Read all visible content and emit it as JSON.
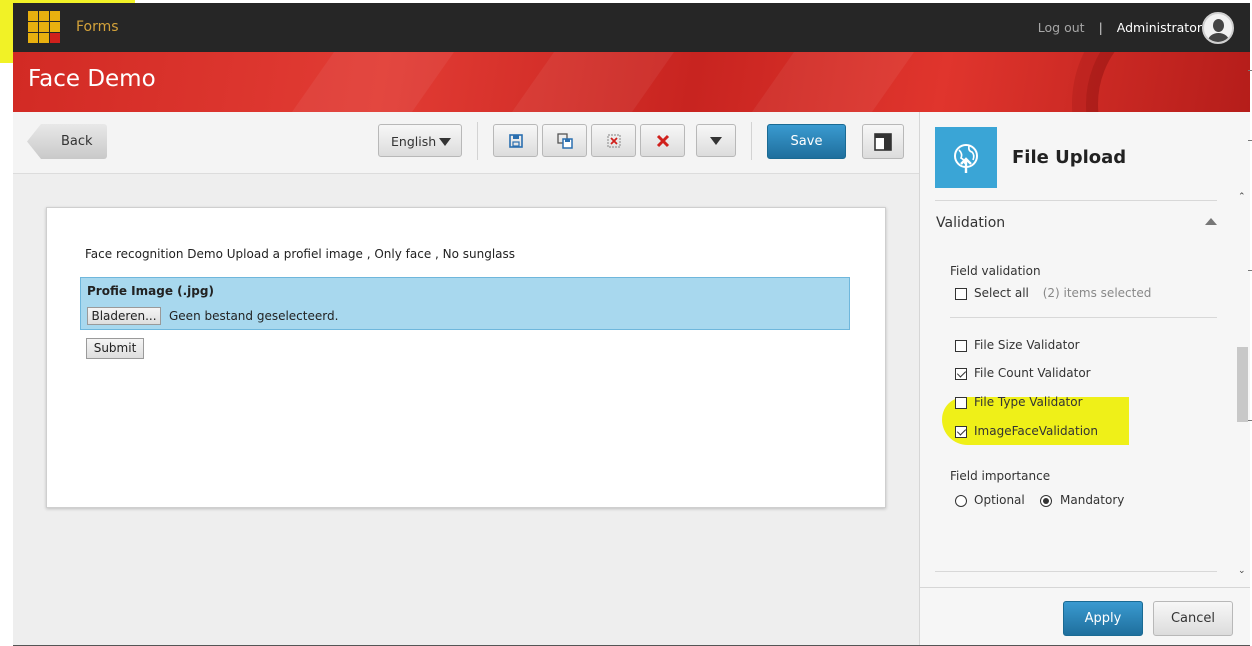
{
  "topbar": {
    "app_name": "Forms",
    "logout": "Log out",
    "separator": "|",
    "user": "Administrator"
  },
  "header": {
    "page_title": "Face Demo"
  },
  "toolbar": {
    "back_label": "Back",
    "language": "English",
    "save_label": "Save",
    "icons": [
      "save-icon",
      "save-as-icon",
      "discard-icon",
      "delete-icon",
      "more-dropdown-icon",
      "layout-panel-icon"
    ]
  },
  "form": {
    "description": "Face recognition Demo Upload a profiel image , Only face , No sunglass",
    "field_label": "Profie Image (.jpg)",
    "browse_label": "Bladeren...",
    "file_status": "Geen bestand geselecteerd.",
    "submit_label": "Submit"
  },
  "properties": {
    "element_title": "File Upload",
    "section_title": "Validation",
    "field_validation_label": "Field validation",
    "select_all_label": "Select all",
    "selected_count": "(2) items selected",
    "validators": [
      {
        "label": "File Size Validator",
        "checked": false
      },
      {
        "label": "File Count Validator",
        "checked": true
      },
      {
        "label": "File Type Validator",
        "checked": false
      },
      {
        "label": "ImageFaceValidation",
        "checked": true
      }
    ],
    "importance_label": "Field importance",
    "importance_options": [
      {
        "label": "Optional",
        "selected": false
      },
      {
        "label": "Mandatory",
        "selected": true
      }
    ],
    "apply_label": "Apply",
    "cancel_label": "Cancel"
  },
  "colors": {
    "topbar": "#262626",
    "header_red": "#d22a24",
    "accent_blue": "#2a86bd",
    "highlight_yellow": "#eef000",
    "upload_panel": "#a8d8ee"
  }
}
